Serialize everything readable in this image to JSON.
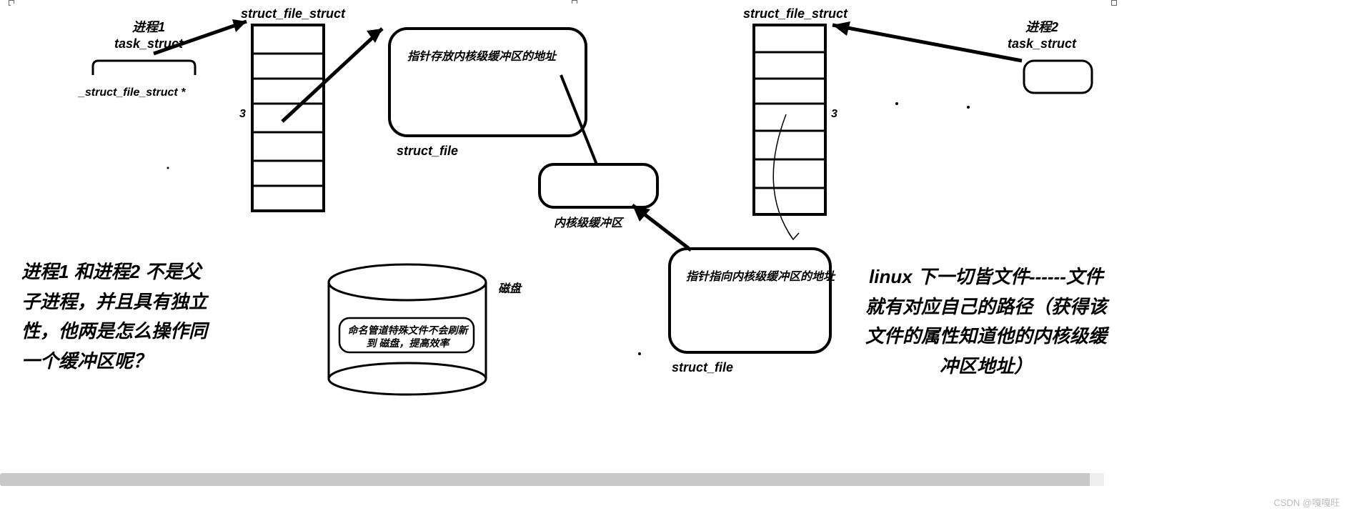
{
  "left_process": {
    "title": "进程1\ntask_struct",
    "ptr_label": "_struct_file_struct *"
  },
  "left_table": {
    "title": "struct_file_struct",
    "idx": "3"
  },
  "struct_file_left": {
    "inner": "指针存放内核级缓冲区的地址",
    "caption": "struct_file"
  },
  "kernel_buffer": {
    "caption": "内核级缓冲区"
  },
  "disk": {
    "caption": "磁盘",
    "inner": "命名管道特殊文件不会刷新到\n磁盘，提高效率"
  },
  "struct_file_right": {
    "inner": "指针指向内核级缓冲区的地址",
    "caption": "struct_file"
  },
  "right_table": {
    "title": "struct_file_struct",
    "idx": "3"
  },
  "right_process": {
    "title": "进程2\ntask_struct"
  },
  "left_para": "进程1 和进程2 不是父子进程，并且具有独立性，他两是怎么操作同一个缓冲区呢？",
  "right_para": "linux 下一切皆文件------文件就有对应自己的路径（获得该文件的属性知道他的内核级缓冲区地址）",
  "watermark": "CSDN @嘎嘎旺"
}
